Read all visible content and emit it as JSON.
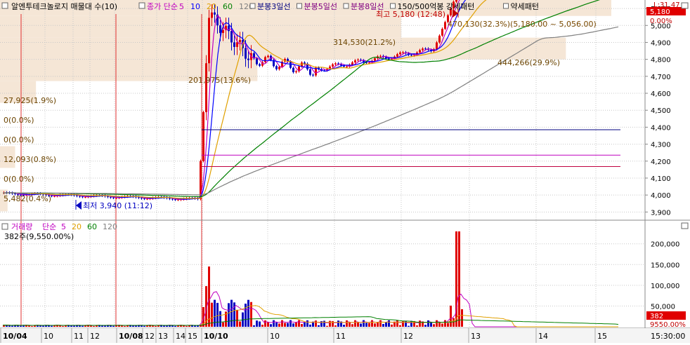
{
  "header": {
    "title": "알엔투테크놀로지 매물대 수(10)",
    "ma_label": "종가 단순",
    "ma_periods": [
      "5",
      "10",
      "20",
      "60",
      "120"
    ],
    "ma_colors": [
      "#c000c0",
      "#0000ff",
      "#e0a000",
      "#008000",
      "#808080"
    ],
    "tick_items": [
      "분봉3일선",
      "분봉5일선",
      "분봉8일선",
      "150/500억봉 강세패턴",
      "약세패턴"
    ],
    "tick_colors": [
      "#000080",
      "#800080",
      "#800080",
      "#000000",
      "#000000"
    ]
  },
  "colors": {
    "up": "#e00000",
    "down": "#0000c0",
    "band": "#f5e6d6",
    "grid": "#c8c8c8"
  },
  "price_chart": {
    "y_ticks": [
      "5,100",
      "5,000",
      "4,900",
      "4,800",
      "4,700",
      "4,600",
      "4,500",
      "4,400",
      "4,300",
      "4,200",
      "4,100",
      "4,000",
      "3,900"
    ],
    "ylim": [
      3860,
      5150
    ],
    "last_price": "5,180",
    "last_change": "0.00%",
    "corner_label": "L:31.47",
    "high_label": "최고 5,180 (12:48)",
    "low_label": "최저 3,940 (11:12)",
    "range_label": "470,130(32.3%)(5,180.00 ~ 5,056.00)",
    "volume_profile": [
      {
        "label": "470,130(32.3%)",
        "low": 5056,
        "high": 5180
      },
      {
        "label": "314,530(21.2%)",
        "low": 4928,
        "high": 5056
      },
      {
        "label": "444,266(29.9%)",
        "low": 4800,
        "high": 4928
      },
      {
        "label": "201,975(13.6%)",
        "low": 4672,
        "high": 4800
      },
      {
        "label": "27,925(1.9%)",
        "low": 4544,
        "high": 4672
      },
      {
        "label": "0(0.0%)",
        "low": 4416,
        "high": 4544
      },
      {
        "label": "0(0.0%)",
        "low": 4288,
        "high": 4416
      },
      {
        "label": "12,093(0.8%)",
        "low": 4160,
        "high": 4288
      },
      {
        "label": "0(0.0%)",
        "low": 4032,
        "high": 4160
      },
      {
        "label": "5,482(0.4%)",
        "low": 3904,
        "high": 4032
      }
    ],
    "ref_lines": [
      {
        "price": 5176,
        "color": "#e0a000"
      },
      {
        "price": 4385,
        "color": "#000080"
      },
      {
        "price": 4235,
        "color": "#c000c0"
      },
      {
        "price": 4168,
        "color": "#c00040"
      }
    ]
  },
  "volume_chart": {
    "legend_label": "거래량",
    "ma_label": "단순",
    "ma_periods": [
      "5",
      "20",
      "60",
      "120"
    ],
    "ma_colors": [
      "#c000c0",
      "#e0a000",
      "#008000",
      "#808080"
    ],
    "stat": "382주(9,550.00%)",
    "y_ticks": [
      "200,000",
      "150,000",
      "100,000",
      "50,000"
    ],
    "ylim": [
      0,
      230000
    ],
    "last_volume": "382",
    "last_pct": "9550.00%"
  },
  "x_axis": {
    "labels": [
      "10/04",
      "10",
      "11",
      "12",
      "10/08",
      "12",
      "13",
      "14",
      "15",
      "10/10",
      "10",
      "11",
      "12",
      "13",
      "14",
      "15"
    ],
    "bold": [
      true,
      false,
      false,
      false,
      true,
      false,
      false,
      false,
      false,
      true,
      false,
      false,
      false,
      false,
      false,
      false
    ],
    "time": "15:30:00"
  },
  "chart_data": {
    "type": "candlestick",
    "title": "알엔투테크놀로지 매물대 수(10)",
    "price_range": [
      3900,
      5180
    ],
    "high": 5180,
    "low": 3940,
    "close": 5180,
    "volume_peak": 230000,
    "volume_profile_series": [
      {
        "range": [
          5056,
          5180
        ],
        "volume": 470130,
        "pct": 32.3
      },
      {
        "range": [
          4928,
          5056
        ],
        "volume": 314530,
        "pct": 21.2
      },
      {
        "range": [
          4800,
          4928
        ],
        "volume": 444266,
        "pct": 29.9
      },
      {
        "range": [
          4672,
          4800
        ],
        "volume": 201975,
        "pct": 13.6
      },
      {
        "range": [
          4544,
          4672
        ],
        "volume": 27925,
        "pct": 1.9
      },
      {
        "range": [
          4416,
          4544
        ],
        "volume": 0,
        "pct": 0.0
      },
      {
        "range": [
          4288,
          4416
        ],
        "volume": 0,
        "pct": 0.0
      },
      {
        "range": [
          4160,
          4288
        ],
        "volume": 12093,
        "pct": 0.8
      },
      {
        "range": [
          4032,
          4160
        ],
        "volume": 0,
        "pct": 0.0
      },
      {
        "range": [
          3904,
          4032
        ],
        "volume": 5482,
        "pct": 0.4
      }
    ]
  }
}
